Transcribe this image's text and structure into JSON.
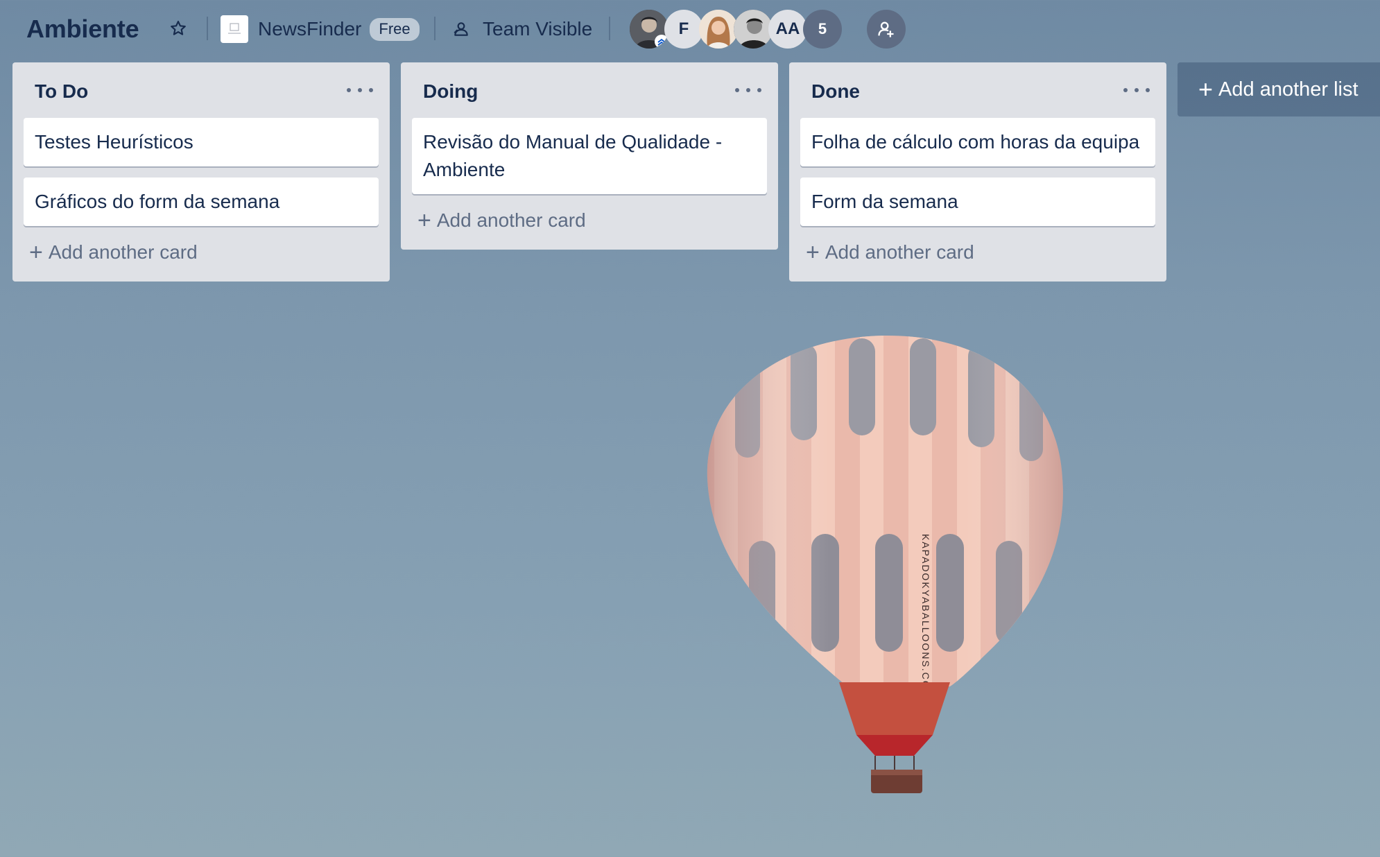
{
  "board": {
    "title": "Ambiente",
    "workspace_name": "NewsFinder",
    "plan_badge": "Free",
    "visibility_label": "Team Visible",
    "members": [
      {
        "type": "photo",
        "name": "member-photo-1",
        "admin": true
      },
      {
        "type": "initial",
        "label": "F"
      },
      {
        "type": "photo",
        "name": "member-photo-2"
      },
      {
        "type": "photo",
        "name": "member-photo-3"
      },
      {
        "type": "initial",
        "label": "AA"
      }
    ],
    "more_members_count": "5",
    "add_list_label": "Add another list",
    "background_image": "hot-air-balloon",
    "balloon_lettering": "KAPADOKYABALLOONS.COM",
    "accent_colors": {
      "text": "#172b4d",
      "list_bg": "#dfe1e6",
      "muted": "#5e6c84"
    }
  },
  "lists": [
    {
      "title": "To Do",
      "cards": [
        "Testes Heurísticos",
        "Gráficos do form da semana"
      ],
      "add_card_label": "Add another card"
    },
    {
      "title": "Doing",
      "cards": [
        "Revisão do Manual de Qualidade - Ambiente"
      ],
      "add_card_label": "Add another card"
    },
    {
      "title": "Done",
      "cards": [
        "Folha de cálculo com horas da equipa",
        "Form da semana"
      ],
      "add_card_label": "Add another card"
    }
  ],
  "icons": {
    "star": "star-icon",
    "visibility": "team-visibility-icon",
    "invite": "add-member-icon",
    "list_menu": "more-horizontal-icon"
  }
}
